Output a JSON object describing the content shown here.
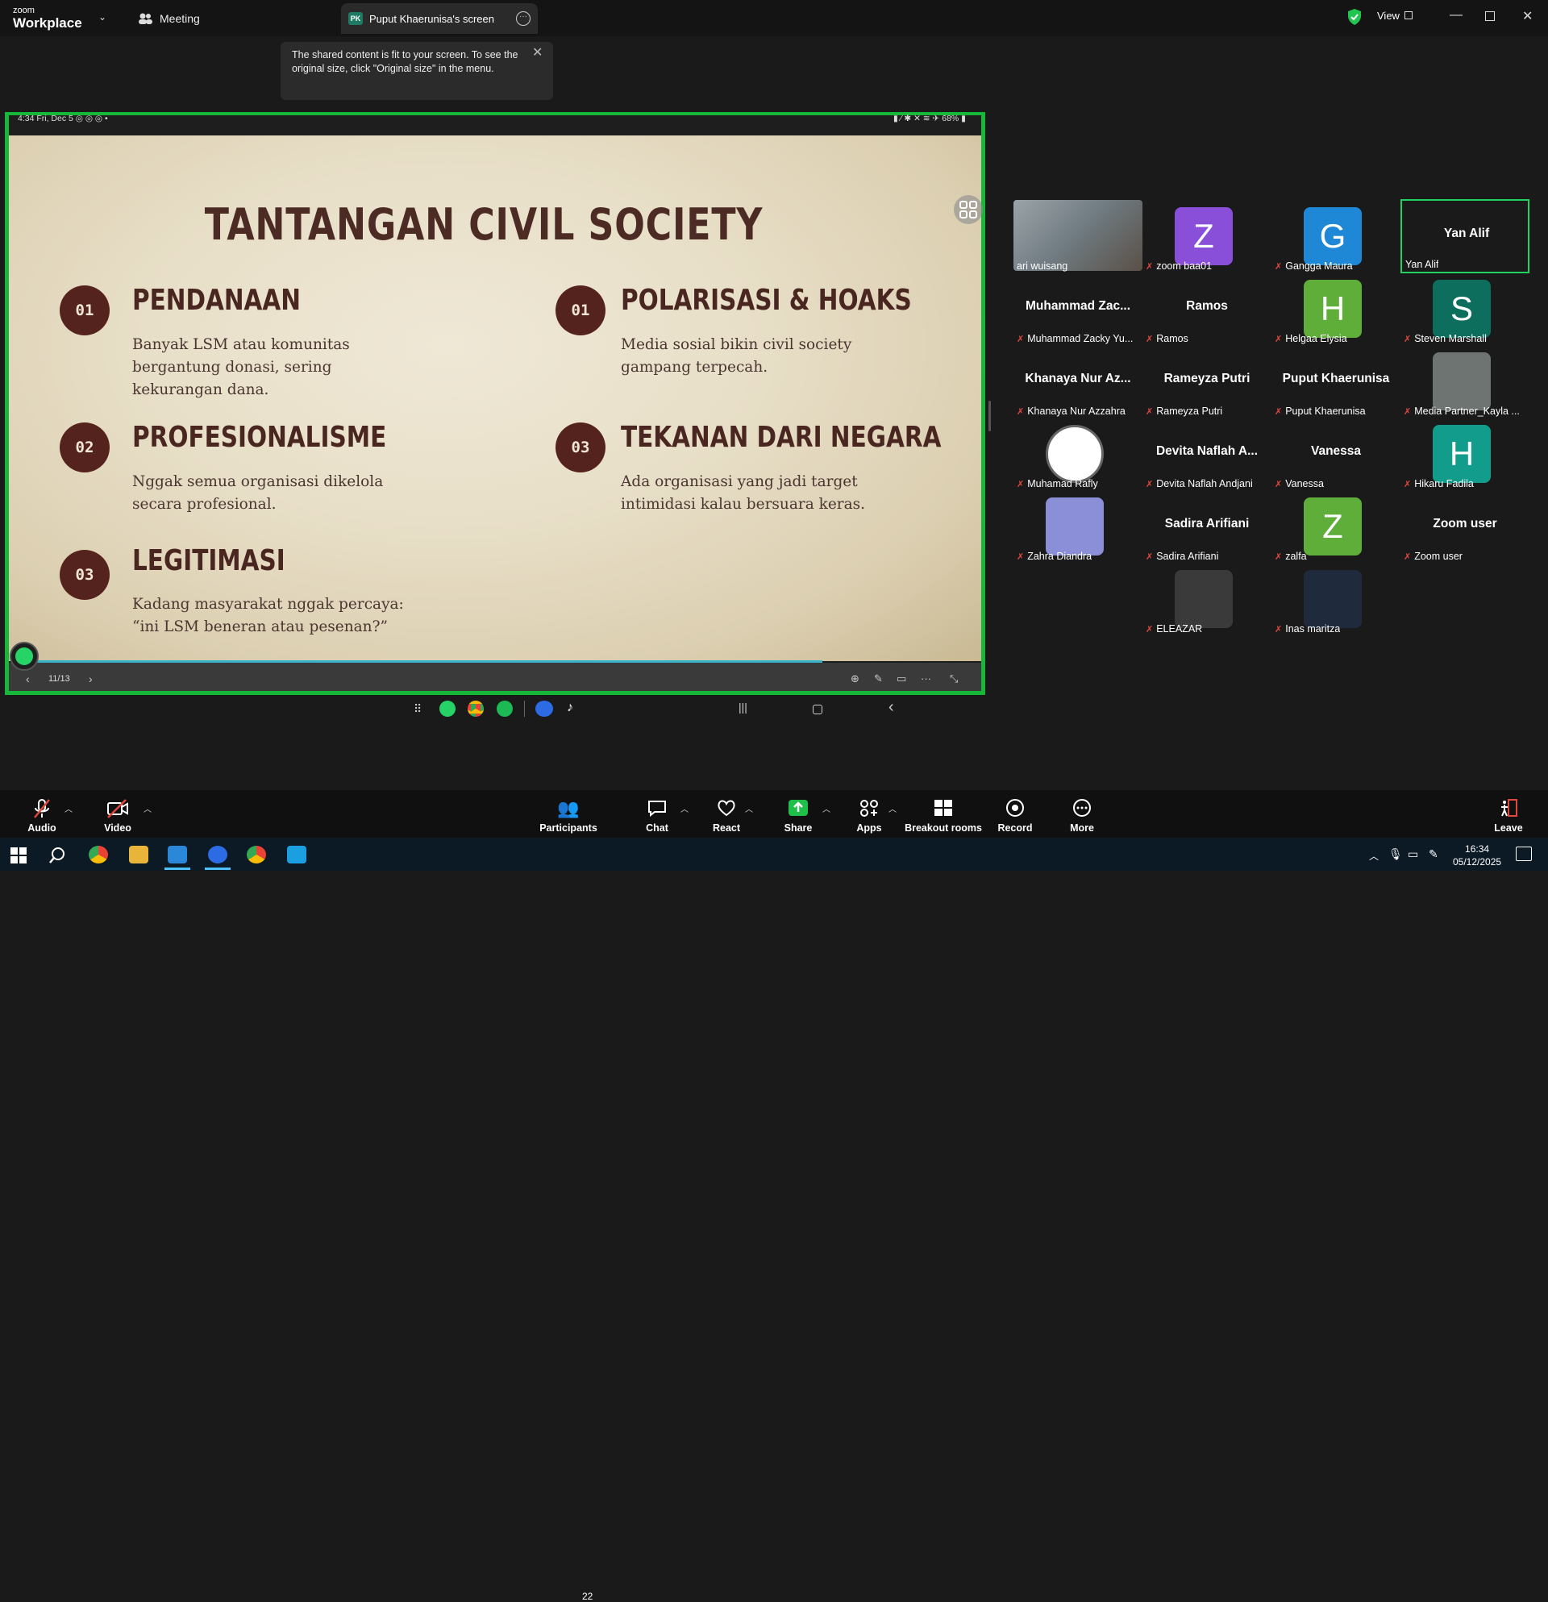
{
  "titlebar": {
    "logo_line1": "zoom",
    "logo_line2": "Workplace",
    "meeting_label": "Meeting",
    "share_badge": "PK",
    "share_tab_title": "Puput Khaerunisa's screen",
    "view_label": "View"
  },
  "tooltip": {
    "text": "The shared content is fit to your screen. To see the original size, click \"Original size\" in the menu."
  },
  "phone_status": {
    "left": "4:34  Fri, Dec 5  ◎ ◎ ◎ •",
    "right": "▮ ⁄ ✱ ✕ ≋ ✈ 68% ▮"
  },
  "slide": {
    "title": "TANTANGAN CIVIL SOCIETY",
    "sections": [
      {
        "num": "01",
        "heading": "PENDANAAN",
        "body": "Banyak LSM atau komunitas\nbergantung donasi, sering\nkekurangan dana."
      },
      {
        "num": "02",
        "heading": "PROFESIONALISME",
        "body": "Nggak semua organisasi dikelola\nsecara profesional."
      },
      {
        "num": "03",
        "heading": "LEGITIMASI",
        "body": "Kadang masyarakat nggak percaya:\n“ini LSM beneran atau pesenan?”"
      },
      {
        "num": "01",
        "heading": "POLARISASI & HOAKS",
        "body": "Media sosial bikin civil society\ngampang terpecah."
      },
      {
        "num": "03",
        "heading": "TEKANAN DARI NEGARA",
        "body": "Ada organisasi yang jadi target\nintimidasi kalau bersuara keras."
      }
    ],
    "page_indicator": "11/13",
    "progress": 0.835
  },
  "gallery": [
    {
      "label": "ari wuisang",
      "center": "",
      "avatar": "",
      "color": "",
      "kind": "video",
      "muted": false
    },
    {
      "label": "zoom baa01",
      "center": "",
      "avatar": "Z",
      "color": "#8a4fd8",
      "kind": "avatar",
      "muted": true
    },
    {
      "label": "Gangga Maura",
      "center": "",
      "avatar": "G",
      "color": "#1e88d6",
      "kind": "avatar",
      "muted": true
    },
    {
      "label": "Yan Alif",
      "center": "Yan Alif",
      "avatar": "",
      "color": "",
      "kind": "name",
      "muted": false
    },
    {
      "label": "Muhammad Zacky Yu...",
      "center": "Muhammad  Zac...",
      "avatar": "",
      "color": "",
      "kind": "name",
      "muted": true
    },
    {
      "label": "Ramos",
      "center": "Ramos",
      "avatar": "",
      "color": "",
      "kind": "name",
      "muted": true
    },
    {
      "label": "Helgaa Elysia",
      "center": "",
      "avatar": "H",
      "color": "#5fae3a",
      "kind": "avatar",
      "muted": true
    },
    {
      "label": "Steven Marshall",
      "center": "",
      "avatar": "S",
      "color": "#0d6e5e",
      "kind": "avatar",
      "muted": true
    },
    {
      "label": "Khanaya Nur Azzahra",
      "center": "Khanaya Nur Az...",
      "avatar": "",
      "color": "",
      "kind": "name",
      "muted": true
    },
    {
      "label": "Rameyza Putri",
      "center": "Rameyza Putri",
      "avatar": "",
      "color": "",
      "kind": "name",
      "muted": true
    },
    {
      "label": "Puput Khaerunisa",
      "center": "Puput Khaerunisa",
      "avatar": "",
      "color": "",
      "kind": "name",
      "muted": true
    },
    {
      "label": "Media Partner_Kayla ...",
      "center": "",
      "avatar": "",
      "color": "#6d7472",
      "kind": "photo",
      "muted": true
    },
    {
      "label": "Muhamad Rafly",
      "center": "",
      "avatar": "",
      "color": "#ffffff",
      "kind": "logo",
      "muted": true
    },
    {
      "label": "Devita Naflah Andjani",
      "center": "Devita Naflah A...",
      "avatar": "",
      "color": "",
      "kind": "name",
      "muted": true
    },
    {
      "label": "Vanessa",
      "center": "Vanessa",
      "avatar": "",
      "color": "",
      "kind": "name",
      "muted": true
    },
    {
      "label": "Hikaru Fadila",
      "center": "",
      "avatar": "H",
      "color": "#119c8c",
      "kind": "avatar",
      "muted": true
    },
    {
      "label": "Zahra Diandra",
      "center": "",
      "avatar": "",
      "color": "#8a8fd8",
      "kind": "photo",
      "muted": true
    },
    {
      "label": "Sadira Arifiani",
      "center": "Sadira Arifiani",
      "avatar": "",
      "color": "",
      "kind": "name",
      "muted": true
    },
    {
      "label": "zalfa",
      "center": "",
      "avatar": "Z",
      "color": "#5fae3a",
      "kind": "avatar",
      "muted": true
    },
    {
      "label": "Zoom user",
      "center": "Zoom user",
      "avatar": "",
      "color": "",
      "kind": "name",
      "muted": true
    },
    {
      "label": "ELEAZAR",
      "center": "",
      "avatar": "",
      "color": "#3a3a3a",
      "kind": "photo",
      "muted": true
    },
    {
      "label": "Inas maritza",
      "center": "",
      "avatar": "",
      "color": "#1f2a3c",
      "kind": "photo",
      "muted": true
    }
  ],
  "toolbar": {
    "audio": "Audio",
    "video": "Video",
    "participants": "Participants",
    "participants_count": "22",
    "chat": "Chat",
    "react": "React",
    "share": "Share",
    "apps": "Apps",
    "breakout": "Breakout rooms",
    "record": "Record",
    "more": "More",
    "leave": "Leave room"
  },
  "taskbar": {
    "time": "16:34",
    "date": "05/12/2025"
  },
  "colors": {
    "share_border": "#17b83a",
    "active_speaker": "#23d160",
    "slide_accent": "#55231d",
    "share_green": "#1fbf4a"
  }
}
